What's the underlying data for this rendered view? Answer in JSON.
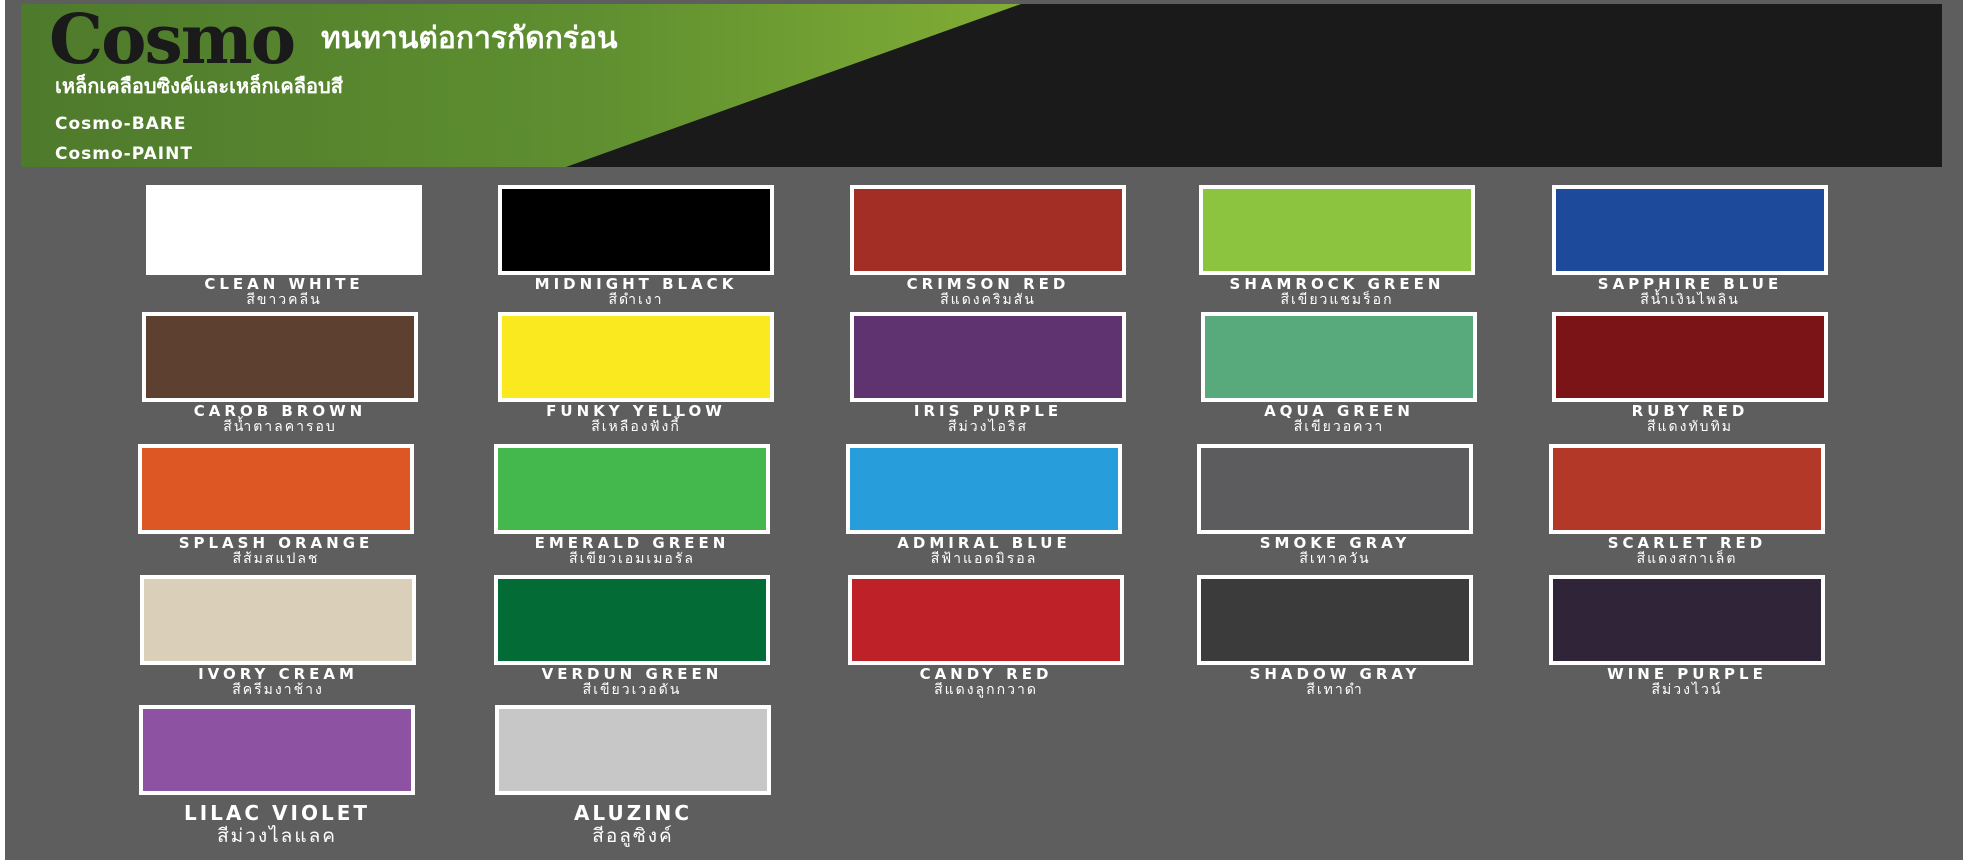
{
  "header": {
    "logo": "Cosmo",
    "tagline": "ทนทานต่อการกัดกร่อน",
    "subtitle": "เหล็กเคลือบซิงค์และเหล็กเคลือบสี",
    "product_bare": "Cosmo-BARE",
    "product_paint": "Cosmo-PAINT"
  },
  "swatches": [
    {
      "en": "CLEAN WHITE",
      "th": "สีขาวคลีน",
      "color": "#ffffff"
    },
    {
      "en": "MIDNIGHT BLACK",
      "th": "สีดำเงา",
      "color": "#000000"
    },
    {
      "en": "CRIMSON RED",
      "th": "สีแดงคริมสัน",
      "color": "#a32e25"
    },
    {
      "en": "SHAMROCK GREEN",
      "th": "สีเขียวแชมร็อก",
      "color": "#8cc43f"
    },
    {
      "en": "SAPPHIRE BLUE",
      "th": "สีน้ำเงินไพลิน",
      "color": "#1d4a9a"
    },
    {
      "en": "CAROB BROWN",
      "th": "สีน้ำตาลคารอบ",
      "color": "#5e4030"
    },
    {
      "en": "FUNKY YELLOW",
      "th": "สีเหลืองฟังกี้",
      "color": "#fbe920"
    },
    {
      "en": "IRIS PURPLE",
      "th": "สีม่วงไอริส",
      "color": "#5e3370"
    },
    {
      "en": "AQUA GREEN",
      "th": "สีเขียวอควา",
      "color": "#58aa7d"
    },
    {
      "en": "RUBY RED",
      "th": "สีแดงทับทิม",
      "color": "#7a1416"
    },
    {
      "en": "SPLASH ORANGE",
      "th": "สีส้มสแปลช",
      "color": "#dd5725"
    },
    {
      "en": "EMERALD GREEN",
      "th": "สีเขียวเอมเมอรัล",
      "color": "#44b84c"
    },
    {
      "en": "ADMIRAL BLUE",
      "th": "สีฟ้าแอดมิรอล",
      "color": "#279edb"
    },
    {
      "en": "SMOKE GRAY",
      "th": "สีเทาควัน",
      "color": "#5c5c5e"
    },
    {
      "en": "SCARLET RED",
      "th": "สีแดงสกาเล็ต",
      "color": "#b43828"
    },
    {
      "en": "IVORY CREAM",
      "th": "สีครีมงาช้าง",
      "color": "#dacfb9"
    },
    {
      "en": "VERDUN GREEN",
      "th": "สีเขียวเวอดัน",
      "color": "#036b36"
    },
    {
      "en": "CANDY RED",
      "th": "สีแดงลูกกวาด",
      "color": "#be2127"
    },
    {
      "en": "SHADOW GRAY",
      "th": "สีเทาดำ",
      "color": "#3b3b3b"
    },
    {
      "en": "WINE PURPLE",
      "th": "สีม่วงไวน์",
      "color": "#2f2438"
    },
    {
      "en": "LILAC VIOLET",
      "th": "สีม่วงไลแลค",
      "color": "#8d52a1"
    },
    {
      "en": "ALUZINC",
      "th": "สีอลูซิงค์",
      "color": "#c7c7c7"
    }
  ]
}
